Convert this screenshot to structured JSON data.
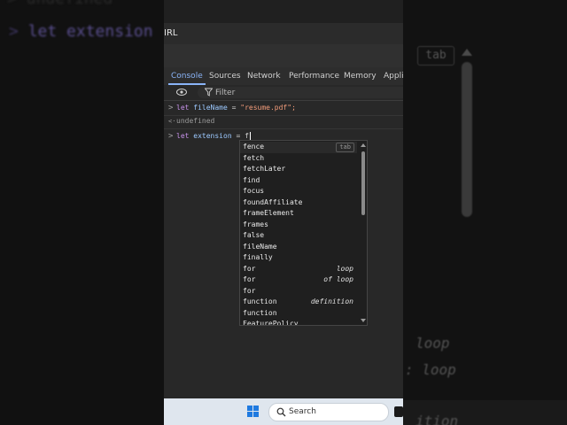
{
  "background": {
    "left_ghost_top": "> undefined",
    "left_ghost_prompt": ">",
    "left_ghost_keyword": "let",
    "left_ghost_name": "extension",
    "right_ghost_tab": "tab",
    "right_ghost_loop1": "loop",
    "right_ghost_loop2": ": loop",
    "right_ghost_bottom": "ition"
  },
  "browser": {
    "url_fragment": "IRL"
  },
  "devtools": {
    "tabs": [
      {
        "label": "Console",
        "active": true
      },
      {
        "label": "Sources",
        "active": false
      },
      {
        "label": "Network",
        "active": false
      },
      {
        "label": "Performance",
        "active": false
      },
      {
        "label": "Memory",
        "active": false
      },
      {
        "label": "Applic",
        "active": false
      }
    ],
    "filter_placeholder": "Filter",
    "accent_color": "#8ab4f8"
  },
  "console": {
    "line1": {
      "prompt": ">",
      "kw": "let",
      "name": "fileName",
      "op": " = ",
      "value": "\"resume.pdf\";"
    },
    "line2": {
      "prompt": "<·",
      "value": "undefined"
    },
    "line3": {
      "prompt": ">",
      "kw": "let",
      "name": "extension",
      "op": " = ",
      "typed": "f"
    }
  },
  "autocomplete": {
    "tab_badge": "tab",
    "items": [
      {
        "name": "fence",
        "hint": ""
      },
      {
        "name": "fetch",
        "hint": ""
      },
      {
        "name": "fetchLater",
        "hint": ""
      },
      {
        "name": "find",
        "hint": ""
      },
      {
        "name": "focus",
        "hint": ""
      },
      {
        "name": "foundAffiliate",
        "hint": ""
      },
      {
        "name": "frameElement",
        "hint": ""
      },
      {
        "name": "frames",
        "hint": ""
      },
      {
        "name": "false",
        "hint": ""
      },
      {
        "name": "fileName",
        "hint": ""
      },
      {
        "name": "finally",
        "hint": ""
      },
      {
        "name": "for",
        "hint": "loop"
      },
      {
        "name": "for",
        "hint": "of loop"
      },
      {
        "name": "for",
        "hint": ""
      },
      {
        "name": "function",
        "hint": "definition"
      },
      {
        "name": "function",
        "hint": ""
      },
      {
        "name": "FeaturePolicy",
        "hint": ""
      }
    ]
  },
  "taskbar": {
    "search_label": "Search"
  }
}
